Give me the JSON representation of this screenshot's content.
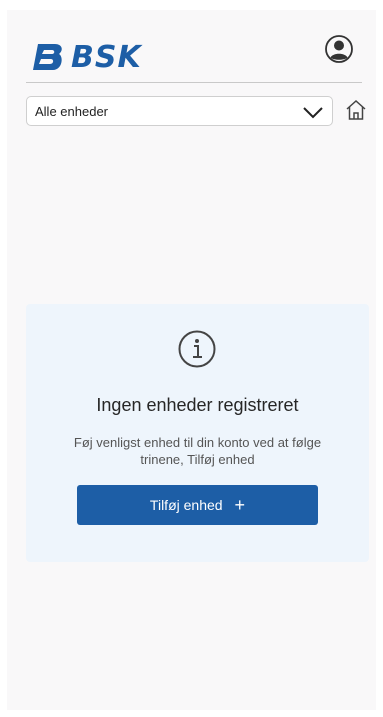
{
  "brand": {
    "logo_text": "BSK",
    "color": "#1d5ea6"
  },
  "header": {
    "profile_icon": "user-circle-icon"
  },
  "device_filter": {
    "selected": "Alle enheder",
    "chevron_icon": "chevron-down-icon",
    "home_icon": "home-icon"
  },
  "empty_state": {
    "icon": "info-icon",
    "title": "Ingen enheder registreret",
    "message": "Føj venligst enhed til din konto ved at følge trinene, Tilføj enhed",
    "button_label": "Tilføj enhed",
    "button_icon": "plus-icon",
    "card_color": "#eef5fc"
  }
}
